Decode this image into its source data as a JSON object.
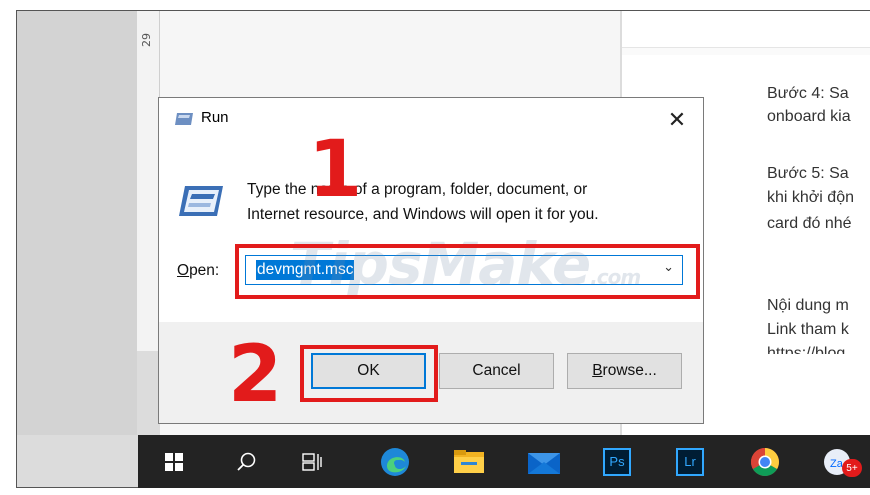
{
  "ruler": {
    "number": "29"
  },
  "right_page": {
    "lines": [
      "Bước 4: Sa",
      "onboard kia",
      "Bước 5:  Sa",
      "khi khởi độn",
      "card đó nhé",
      "Nội dung m",
      "Link tham k",
      "https://blog"
    ]
  },
  "dialog": {
    "title": "Run",
    "close_symbol": "✕",
    "description_line1": "Type the name of a program, folder, document, or",
    "description_line2": "Internet resource, and Windows will open it for you.",
    "open_label_underlined": "O",
    "open_label_rest": "pen:",
    "open_value": "devmgmt.msc",
    "ok_label": "OK",
    "cancel_label": "Cancel",
    "browse_underlined": "B",
    "browse_rest": "rowse..."
  },
  "annotations": {
    "step1": "1",
    "step2": "2"
  },
  "watermark": {
    "main": "TipsMake",
    "suffix": ".com"
  },
  "taskbar": {
    "items": [
      {
        "icon": "windows-start-icon"
      },
      {
        "icon": "search-icon"
      },
      {
        "icon": "task-view-icon"
      },
      {
        "icon": "edge-icon"
      },
      {
        "icon": "file-explorer-icon"
      },
      {
        "icon": "mail-icon"
      },
      {
        "icon": "photoshop-icon",
        "label": "Ps"
      },
      {
        "icon": "lightroom-icon",
        "label": "Lr"
      },
      {
        "icon": "chrome-icon"
      },
      {
        "icon": "zalo-icon",
        "badge": "5+"
      }
    ]
  },
  "colors": {
    "accent": "#0078d7",
    "highlight_red": "#e21b1b",
    "taskbar": "#232323"
  }
}
